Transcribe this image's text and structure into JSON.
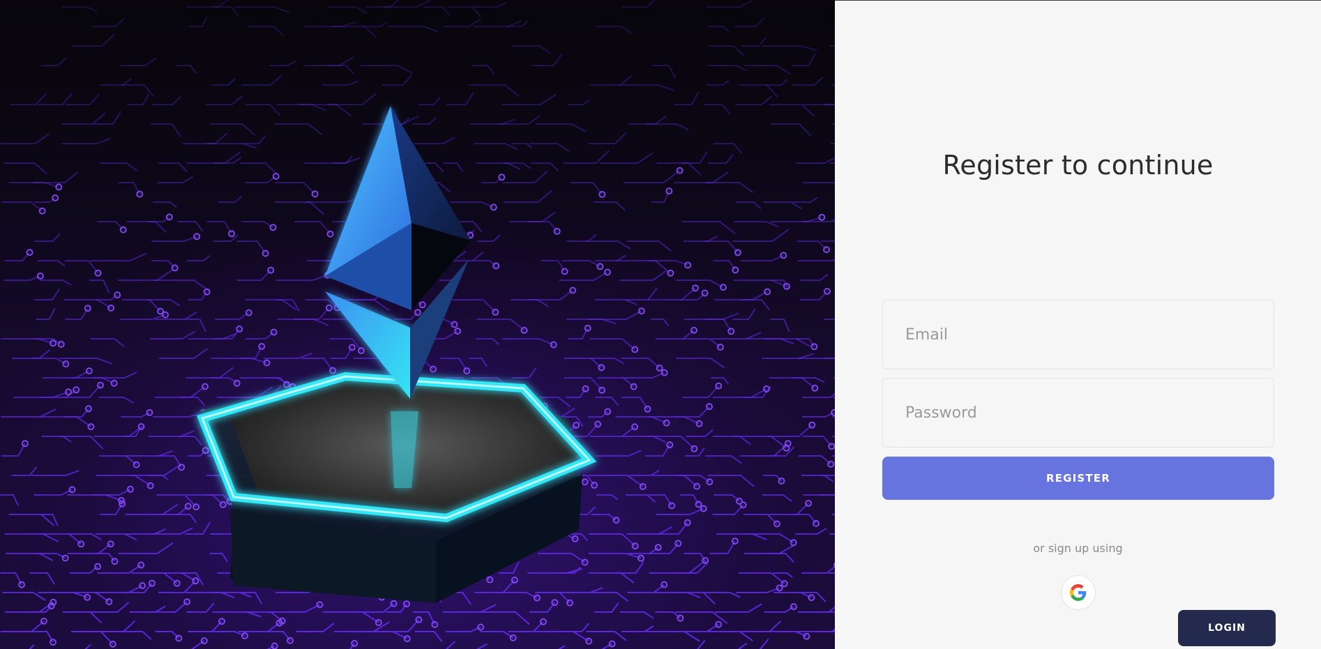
{
  "hero": {
    "image": "ethereum-logo-on-circuit-board",
    "colors": {
      "circuit": "#6a2dff",
      "glow": "#35e6f5",
      "crystal": "#3d8ff0"
    }
  },
  "form": {
    "title": "Register to continue",
    "email_placeholder": "Email",
    "email_value": "",
    "password_placeholder": "Password",
    "password_value": "",
    "register_label": "REGISTER",
    "alt_signup_text": "or sign up using",
    "google_icon": "google-icon",
    "login_label": "LOGIN"
  },
  "colors": {
    "accent": "#6774e0",
    "login_button": "#242a4d",
    "panel_background": "#f6f6f6"
  }
}
